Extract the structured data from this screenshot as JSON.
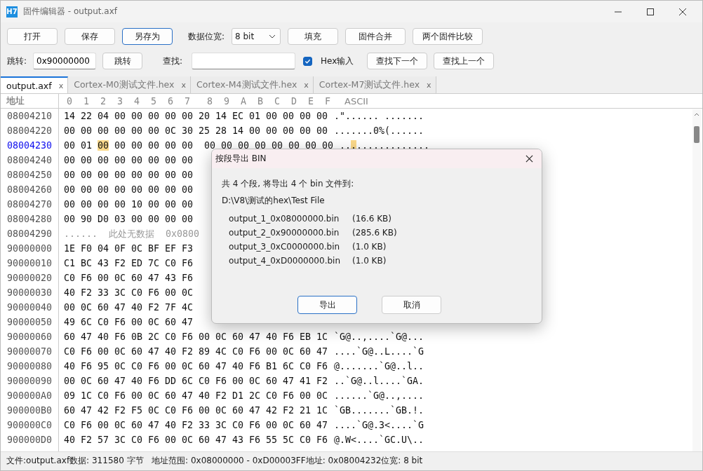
{
  "window": {
    "icon_text": "H7",
    "title": "固件编辑器 - output.axf"
  },
  "toolbar": {
    "buttons": [
      {
        "label": "打开",
        "focused": false
      },
      {
        "label": "保存",
        "focused": false
      },
      {
        "label": "另存为",
        "focused": true
      }
    ],
    "width_label": "数据位宽:",
    "width_select": "8 bit",
    "buttons2": [
      {
        "label": "填充"
      },
      {
        "label": "固件合并"
      },
      {
        "label": "两个固件比较"
      }
    ],
    "jump_label": "跳转:",
    "jump_value": "0x90000000",
    "jump_button": "跳转",
    "find_label": "查找:",
    "hex_input": {
      "label": "Hex输入",
      "checked": true
    },
    "find_next": "查找下一个",
    "find_prev": "查找上一个"
  },
  "tabs": [
    {
      "label": "output.axf",
      "close": "x",
      "selected": true
    },
    {
      "label": "Cortex-M0测试文件.hex",
      "close": "x",
      "selected": false
    },
    {
      "label": "Cortex-M4测试文件.hex",
      "close": "x",
      "selected": false
    },
    {
      "label": "Cortex-M7测试文件.hex",
      "close": "x",
      "selected": false
    }
  ],
  "hex_view": {
    "address_header": "地址",
    "columns": [
      "0",
      "1",
      "2",
      "3",
      "4",
      "5",
      "6",
      "7",
      "8",
      "9",
      "A",
      "B",
      "C",
      "D",
      "E",
      "F"
    ],
    "ascii_header": "ASCII",
    "rows": [
      {
        "kind": "data",
        "address": "08004210",
        "lo": "14 22 04 00 00 00 00 00",
        "hi": "20 14 EC 01 00 00 00 00",
        "ascii": ".\"...... ......."
      },
      {
        "kind": "data",
        "address": "08004220",
        "lo": "00 00 00 00 00 00 0C 30",
        "hi": "25 28 14 00 00 00 00 00",
        "ascii": ".......0%(......"
      },
      {
        "kind": "current",
        "address": "08004230",
        "bytes": [
          {
            "value": "00",
            "selected": false
          },
          {
            "value": "01",
            "selected": false
          },
          {
            "value": "00",
            "selected": true
          },
          {
            "value": "00",
            "selected": false
          },
          {
            "value": "00",
            "selected": false
          },
          {
            "value": "00",
            "selected": false
          },
          {
            "value": "00",
            "selected": false
          },
          {
            "value": "00",
            "selected": false
          },
          {
            "value": "00",
            "selected": false
          },
          {
            "value": "00",
            "selected": false
          },
          {
            "value": "00",
            "selected": false
          },
          {
            "value": "00",
            "selected": false
          },
          {
            "value": "00",
            "selected": false
          },
          {
            "value": "00",
            "selected": false
          },
          {
            "value": "00",
            "selected": false
          },
          {
            "value": "00",
            "selected": false
          }
        ],
        "ascii": [
          {
            "char": ".",
            "selected": false
          },
          {
            "char": ".",
            "selected": false
          },
          {
            "char": ".",
            "selected": true
          },
          {
            "char": ".",
            "selected": false
          },
          {
            "char": ".",
            "selected": false
          },
          {
            "char": ".",
            "selected": false
          },
          {
            "char": ".",
            "selected": false
          },
          {
            "char": ".",
            "selected": false
          },
          {
            "char": ".",
            "selected": false
          },
          {
            "char": ".",
            "selected": false
          },
          {
            "char": ".",
            "selected": false
          },
          {
            "char": ".",
            "selected": false
          },
          {
            "char": ".",
            "selected": false
          },
          {
            "char": ".",
            "selected": false
          },
          {
            "char": ".",
            "selected": false
          },
          {
            "char": ".",
            "selected": false
          }
        ]
      },
      {
        "kind": "data",
        "address": "08004240",
        "lo": "00 00 00 00 00 00 00 00"
      },
      {
        "kind": "data",
        "address": "08004250",
        "lo": "00 00 00 00 00 00 00 00"
      },
      {
        "kind": "data",
        "address": "08004260",
        "lo": "00 00 00 00 00 00 00 00"
      },
      {
        "kind": "data",
        "address": "08004270",
        "lo": "00 00 00 00 10 00 00 00"
      },
      {
        "kind": "data",
        "address": "08004280",
        "lo": "00 90 D0 03 00 00 00 00"
      },
      {
        "kind": "gap",
        "address": "08004290",
        "dots": "......",
        "note": "此处无数据",
        "next": "0x0800"
      },
      {
        "kind": "data",
        "address": "90000000",
        "lo": "1E F0 04 0F 0C BF EF F3"
      },
      {
        "kind": "data",
        "address": "90000010",
        "lo": "C1 BC 43 F2 ED 7C C0 F6"
      },
      {
        "kind": "data",
        "address": "90000020",
        "lo": "C0 F6 00 0C 60 47 43 F6"
      },
      {
        "kind": "data",
        "address": "90000030",
        "lo": "40 F2 33 3C C0 F6 00 0C"
      },
      {
        "kind": "data",
        "address": "90000040",
        "lo": "00 0C 60 47 40 F2 7F 4C"
      },
      {
        "kind": "data",
        "address": "90000050",
        "lo": "49 6C C0 F6 00 0C 60 47"
      },
      {
        "kind": "data",
        "address": "90000060",
        "lo": "60 47 40 F6 0B 2C C0 F6",
        "hi": "00 0C 60 47 40 F6 EB 1C",
        "ascii": "`G@..,....`G@..."
      },
      {
        "kind": "data",
        "address": "90000070",
        "lo": "C0 F6 00 0C 60 47 40 F2",
        "hi": "89 4C C0 F6 00 0C 60 47",
        "ascii": "....`G@..L....`G"
      },
      {
        "kind": "data",
        "address": "90000080",
        "lo": "40 F6 95 0C C0 F6 00 0C",
        "hi": "60 47 40 F6 B1 6C C0 F6",
        "ascii": "@.......`G@..l.."
      },
      {
        "kind": "data",
        "address": "90000090",
        "lo": "00 0C 60 47 40 F6 DD 6C",
        "hi": "C0 F6 00 0C 60 47 41 F2",
        "ascii": "..`G@..l....`GA."
      },
      {
        "kind": "data",
        "address": "900000A0",
        "lo": "09 1C C0 F6 00 0C 60 47",
        "hi": "40 F2 D1 2C C0 F6 00 0C",
        "ascii": "......`G@..,...."
      },
      {
        "kind": "data",
        "address": "900000B0",
        "lo": "60 47 42 F2 F5 0C C0 F6",
        "hi": "00 0C 60 47 42 F2 21 1C",
        "ascii": "`GB.......`GB.!."
      },
      {
        "kind": "data",
        "address": "900000C0",
        "lo": "C0 F6 00 0C 60 47 40 F2",
        "hi": "33 3C C0 F6 00 0C 60 47",
        "ascii": "....`G@.3<....`G"
      },
      {
        "kind": "data",
        "address": "900000D0",
        "lo": "40 F2 57 3C C0 F6 00 0C",
        "hi": "60 47 43 F6 55 5C C0 F6",
        "ascii": "@.W<....`GC.U\\.."
      }
    ]
  },
  "status_bar": "文件:output.axf数据: 311580 字节   地址范围: 0x08000000 - 0xD00003FF地址: 0x08004232位宽: 8 bit",
  "dialog": {
    "title": "按段导出 BIN",
    "summary": "共 4 个段, 将导出 4 个 bin 文件到:",
    "path": "D:\\V8\\测试的hex\\Test File",
    "files": [
      {
        "name": "output_1_0x08000000.bin",
        "size": "(16.6 KB)"
      },
      {
        "name": "output_2_0x90000000.bin",
        "size": "(285.6 KB)"
      },
      {
        "name": "output_3_0xC0000000.bin",
        "size": "(1.0 KB)"
      },
      {
        "name": "output_4_0xD0000000.bin",
        "size": "(1.0 KB)"
      }
    ],
    "buttons": [
      {
        "label": "导出",
        "primary": true
      },
      {
        "label": "取消",
        "primary": false
      }
    ]
  }
}
